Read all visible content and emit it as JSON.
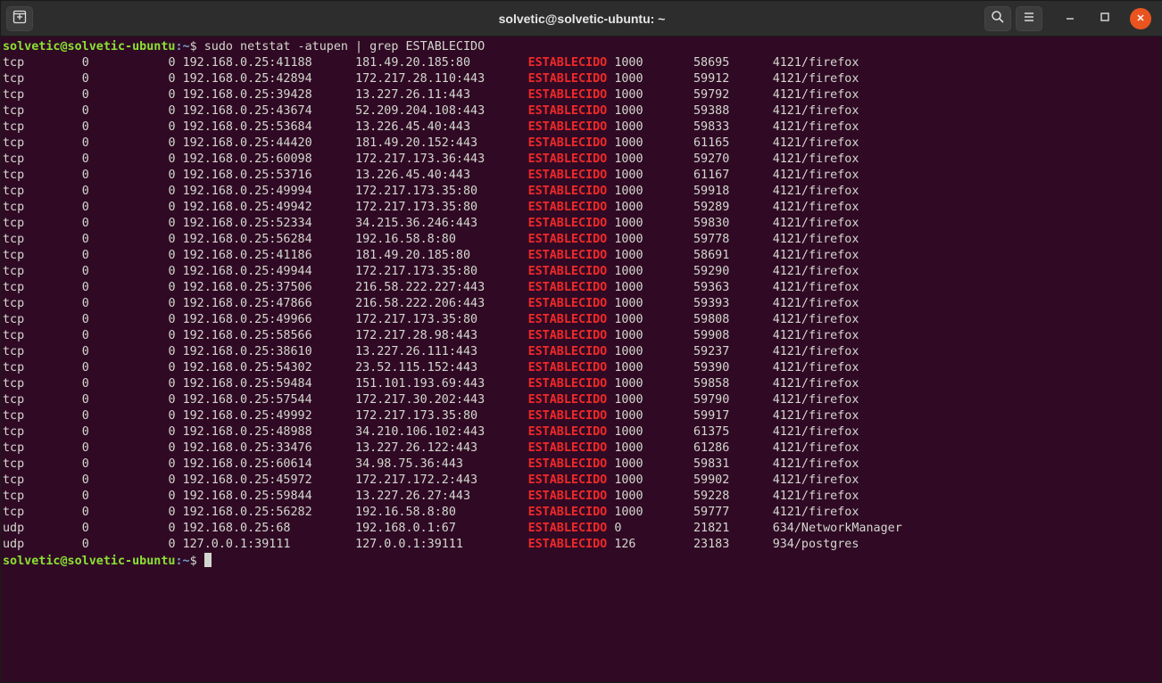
{
  "window": {
    "title": "solvetic@solvetic-ubuntu: ~"
  },
  "icons": {
    "new_tab": "new-tab-icon",
    "search": "search-icon",
    "menu": "hamburger-menu-icon",
    "minimize": "minimize-icon",
    "maximize": "maximize-icon",
    "close": "close-icon"
  },
  "colors": {
    "background": "#300a24",
    "prompt_user": "#8ae234",
    "prompt_path": "#729fcf",
    "match": "#ef2929",
    "text": "#d3d7cf"
  },
  "terminal": {
    "prompt": {
      "user_host": "solvetic@solvetic-ubuntu",
      "path": ":~",
      "symbol": "$ "
    },
    "command": "sudo netstat -atupen | grep ESTABLECIDO",
    "highlight": "ESTABLECIDO",
    "rows": [
      [
        "tcp",
        "0",
        "0",
        "192.168.0.25:41188",
        "181.49.20.185:80",
        "ESTABLECIDO",
        "1000",
        "58695",
        "4121/firefox"
      ],
      [
        "tcp",
        "0",
        "0",
        "192.168.0.25:42894",
        "172.217.28.110:443",
        "ESTABLECIDO",
        "1000",
        "59912",
        "4121/firefox"
      ],
      [
        "tcp",
        "0",
        "0",
        "192.168.0.25:39428",
        "13.227.26.11:443",
        "ESTABLECIDO",
        "1000",
        "59792",
        "4121/firefox"
      ],
      [
        "tcp",
        "0",
        "0",
        "192.168.0.25:43674",
        "52.209.204.108:443",
        "ESTABLECIDO",
        "1000",
        "59388",
        "4121/firefox"
      ],
      [
        "tcp",
        "0",
        "0",
        "192.168.0.25:53684",
        "13.226.45.40:443",
        "ESTABLECIDO",
        "1000",
        "59833",
        "4121/firefox"
      ],
      [
        "tcp",
        "0",
        "0",
        "192.168.0.25:44420",
        "181.49.20.152:443",
        "ESTABLECIDO",
        "1000",
        "61165",
        "4121/firefox"
      ],
      [
        "tcp",
        "0",
        "0",
        "192.168.0.25:60098",
        "172.217.173.36:443",
        "ESTABLECIDO",
        "1000",
        "59270",
        "4121/firefox"
      ],
      [
        "tcp",
        "0",
        "0",
        "192.168.0.25:53716",
        "13.226.45.40:443",
        "ESTABLECIDO",
        "1000",
        "61167",
        "4121/firefox"
      ],
      [
        "tcp",
        "0",
        "0",
        "192.168.0.25:49994",
        "172.217.173.35:80",
        "ESTABLECIDO",
        "1000",
        "59918",
        "4121/firefox"
      ],
      [
        "tcp",
        "0",
        "0",
        "192.168.0.25:49942",
        "172.217.173.35:80",
        "ESTABLECIDO",
        "1000",
        "59289",
        "4121/firefox"
      ],
      [
        "tcp",
        "0",
        "0",
        "192.168.0.25:52334",
        "34.215.36.246:443",
        "ESTABLECIDO",
        "1000",
        "59830",
        "4121/firefox"
      ],
      [
        "tcp",
        "0",
        "0",
        "192.168.0.25:56284",
        "192.16.58.8:80",
        "ESTABLECIDO",
        "1000",
        "59778",
        "4121/firefox"
      ],
      [
        "tcp",
        "0",
        "0",
        "192.168.0.25:41186",
        "181.49.20.185:80",
        "ESTABLECIDO",
        "1000",
        "58691",
        "4121/firefox"
      ],
      [
        "tcp",
        "0",
        "0",
        "192.168.0.25:49944",
        "172.217.173.35:80",
        "ESTABLECIDO",
        "1000",
        "59290",
        "4121/firefox"
      ],
      [
        "tcp",
        "0",
        "0",
        "192.168.0.25:37506",
        "216.58.222.227:443",
        "ESTABLECIDO",
        "1000",
        "59363",
        "4121/firefox"
      ],
      [
        "tcp",
        "0",
        "0",
        "192.168.0.25:47866",
        "216.58.222.206:443",
        "ESTABLECIDO",
        "1000",
        "59393",
        "4121/firefox"
      ],
      [
        "tcp",
        "0",
        "0",
        "192.168.0.25:49966",
        "172.217.173.35:80",
        "ESTABLECIDO",
        "1000",
        "59808",
        "4121/firefox"
      ],
      [
        "tcp",
        "0",
        "0",
        "192.168.0.25:58566",
        "172.217.28.98:443",
        "ESTABLECIDO",
        "1000",
        "59908",
        "4121/firefox"
      ],
      [
        "tcp",
        "0",
        "0",
        "192.168.0.25:38610",
        "13.227.26.111:443",
        "ESTABLECIDO",
        "1000",
        "59237",
        "4121/firefox"
      ],
      [
        "tcp",
        "0",
        "0",
        "192.168.0.25:54302",
        "23.52.115.152:443",
        "ESTABLECIDO",
        "1000",
        "59390",
        "4121/firefox"
      ],
      [
        "tcp",
        "0",
        "0",
        "192.168.0.25:59484",
        "151.101.193.69:443",
        "ESTABLECIDO",
        "1000",
        "59858",
        "4121/firefox"
      ],
      [
        "tcp",
        "0",
        "0",
        "192.168.0.25:57544",
        "172.217.30.202:443",
        "ESTABLECIDO",
        "1000",
        "59790",
        "4121/firefox"
      ],
      [
        "tcp",
        "0",
        "0",
        "192.168.0.25:49992",
        "172.217.173.35:80",
        "ESTABLECIDO",
        "1000",
        "59917",
        "4121/firefox"
      ],
      [
        "tcp",
        "0",
        "0",
        "192.168.0.25:48988",
        "34.210.106.102:443",
        "ESTABLECIDO",
        "1000",
        "61375",
        "4121/firefox"
      ],
      [
        "tcp",
        "0",
        "0",
        "192.168.0.25:33476",
        "13.227.26.122:443",
        "ESTABLECIDO",
        "1000",
        "61286",
        "4121/firefox"
      ],
      [
        "tcp",
        "0",
        "0",
        "192.168.0.25:60614",
        "34.98.75.36:443",
        "ESTABLECIDO",
        "1000",
        "59831",
        "4121/firefox"
      ],
      [
        "tcp",
        "0",
        "0",
        "192.168.0.25:45972",
        "172.217.172.2:443",
        "ESTABLECIDO",
        "1000",
        "59902",
        "4121/firefox"
      ],
      [
        "tcp",
        "0",
        "0",
        "192.168.0.25:59844",
        "13.227.26.27:443",
        "ESTABLECIDO",
        "1000",
        "59228",
        "4121/firefox"
      ],
      [
        "tcp",
        "0",
        "0",
        "192.168.0.25:56282",
        "192.16.58.8:80",
        "ESTABLECIDO",
        "1000",
        "59777",
        "4121/firefox"
      ],
      [
        "udp",
        "0",
        "0",
        "192.168.0.25:68",
        "192.168.0.1:67",
        "ESTABLECIDO",
        "0",
        "21821",
        "634/NetworkManager"
      ],
      [
        "udp",
        "0",
        "0",
        "127.0.0.1:39111",
        "127.0.0.1:39111",
        "ESTABLECIDO",
        "126",
        "23183",
        "934/postgres"
      ]
    ]
  }
}
